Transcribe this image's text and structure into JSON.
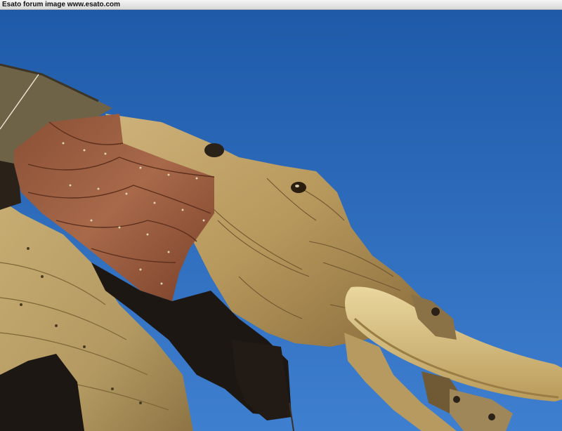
{
  "caption": {
    "text": "Esato forum image www.esato.com"
  },
  "colors": {
    "sky_top": "#1e5aa8",
    "sky_bottom": "#3f7fd0",
    "wood": "#b49a62",
    "wood_dark": "#7d6638",
    "ear_copper": "#9a5a3c",
    "tusk": "#d9c288",
    "shadow": "#1c1712",
    "canopy": "#6e6247"
  },
  "photo": {
    "subject_icon": "mechanical-elephant-photo"
  }
}
